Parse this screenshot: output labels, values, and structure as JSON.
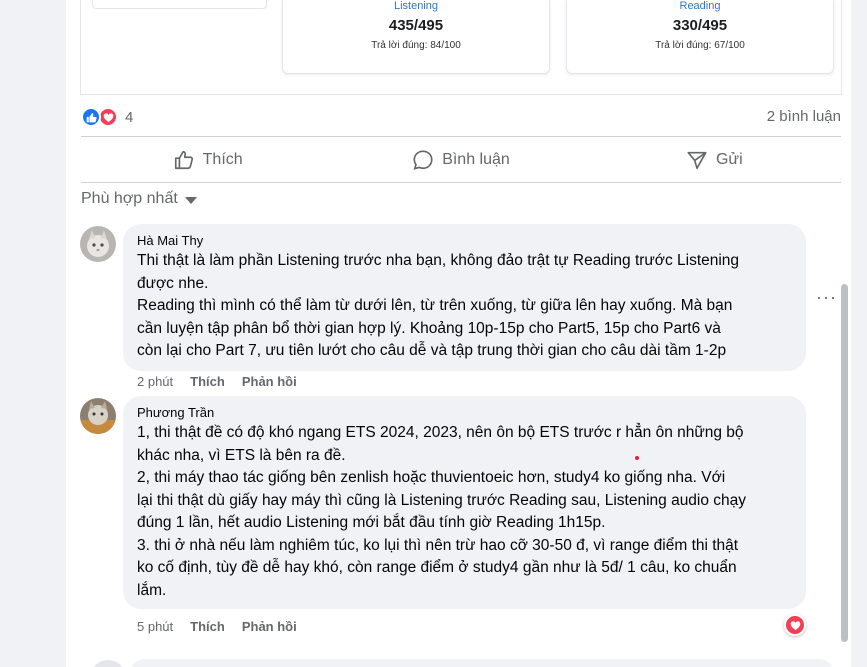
{
  "shared_post": {
    "listening": {
      "label": "Listening",
      "score": "435/495",
      "correct": "Trả lời đúng: 84/100"
    },
    "reading": {
      "label": "Reading",
      "score": "330/495",
      "correct": "Trả lời đúng: 67/100"
    }
  },
  "reactions": {
    "count": "4",
    "comments_count": "2 bình luận",
    "like_color": "#1877f2",
    "love_color": "#f33e58"
  },
  "actions": {
    "like": "Thích",
    "comment": "Bình luận",
    "send": "Gửi"
  },
  "sort_label": "Phù hợp nhất",
  "comments": [
    {
      "author": "Hà Mai Thy",
      "text": "Thi thật là làm phần Listening trước nha bạn, không đảo trật tự Reading trước Listening\nđược nhe.\nReading thì mình có thể làm từ dưới lên, từ trên xuống, từ giữa lên hay xuống. Mà bạn\ncần luyện tập phân bổ thời gian hợp lý. Khoảng 10p-15p cho Part5, 15p cho Part6 và\ncòn lại cho Part 7, ưu tiên lướt cho câu dễ và tập trung thời gian cho câu dài tầm 1-2p",
      "time": "2 phút",
      "like": "Thích",
      "reply": "Phản hồi"
    },
    {
      "author": "Phương Trần",
      "text": "1, thi thật đề có độ khó ngang ETS 2024, 2023, nên ôn bộ ETS trước r hẳn ôn những bộ\nkhác nha, vì ETS là bên ra đề.\n2, thi máy thao tác giống bên zenlish hoặc thuvientoeic hơn, study4 ko giống nha. Với\nlại thi thật dù giấy hay máy thì cũng là Listening trước Reading sau, Listening audio chạy\nđúng 1 lần, hết audio Listening mới bắt đầu tính giờ Reading 1h15p.\n3. thi ở nhà nếu làm nghiêm túc, ko lụi thì nên trừ hao cỡ 30-50 đ, vì range điểm thi thật\nko cố định, tùy đề dễ hay khó, còn range điểm ở study4 gần như là 5đ/ 1 câu, ko chuẩn\nlắm.",
      "time": "5 phút",
      "like": "Thích",
      "reply": "Phản hồi"
    }
  ],
  "icons": {
    "like": "thumbs-up-icon",
    "comment": "speech-bubble-icon",
    "send": "send-icon",
    "more": "more-options-icon",
    "love": "heart-icon"
  }
}
